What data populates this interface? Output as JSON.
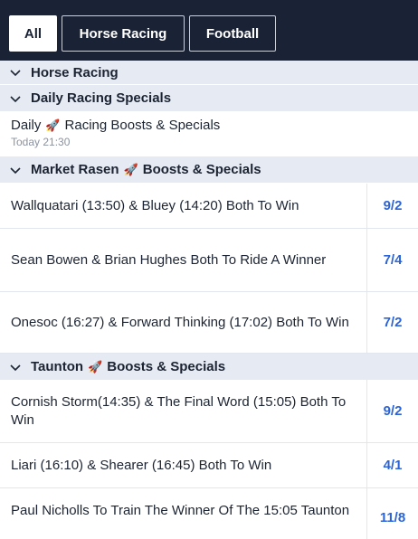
{
  "tabs": [
    "All",
    "Horse Racing",
    "Football"
  ],
  "sections": {
    "horse_racing": "Horse Racing",
    "daily_racing_specials": "Daily Racing Specials",
    "market_rasen": {
      "prefix": "Market Rasen",
      "suffix": "Boosts & Specials"
    },
    "taunton": {
      "prefix": "Taunton",
      "suffix": "Boosts & Specials"
    }
  },
  "daily_item": {
    "prefix": "Daily",
    "suffix": "Racing Boosts & Specials",
    "time": "Today 21:30"
  },
  "market_rasen_selections": [
    {
      "name": "Wallquatari (13:50) & Bluey (14:20) Both To Win",
      "odds": "9/2"
    },
    {
      "name": "Sean Bowen & Brian Hughes Both To Ride A Winner",
      "odds": "7/4"
    },
    {
      "name": "Onesoc (16:27) & Forward Thinking (17:02) Both To Win",
      "odds": "7/2"
    }
  ],
  "taunton_selections": [
    {
      "name": "Cornish Storm(14:35) & The Final Word (15:05) Both To Win",
      "odds": "9/2"
    },
    {
      "name": "Liari (16:10) & Shearer (16:45) Both To Win",
      "odds": "4/1"
    },
    {
      "name": "Paul Nicholls To Train The Winner Of The 15:05 Taunton",
      "odds": "11/8"
    }
  ],
  "icons": {
    "chevron": "chevron-down-icon",
    "rocket": "rocket-icon"
  },
  "colors": {
    "header_bg": "#1a2235",
    "section_bg": "#e6ebf3",
    "odds": "#2b64d8"
  }
}
